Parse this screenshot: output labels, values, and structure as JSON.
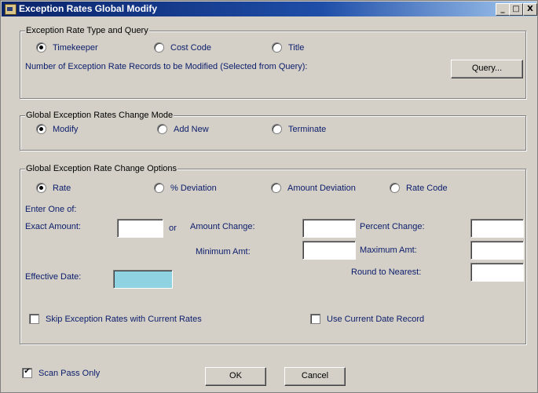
{
  "window": {
    "title": "Exception Rates Global Modify",
    "minimize": "_",
    "maximize": "□",
    "close": "X"
  },
  "type_query": {
    "legend": "Exception Rate Type and Query",
    "options": [
      {
        "label": "Timekeeper",
        "selected": true
      },
      {
        "label": "Cost Code",
        "selected": false
      },
      {
        "label": "Title",
        "selected": false
      }
    ],
    "records_label": "Number of Exception Rate Records to be Modified (Selected from Query):",
    "query_button": "Query..."
  },
  "change_mode": {
    "legend": "Global Exception Rates Change Mode",
    "options": [
      {
        "label": "Modify",
        "selected": true
      },
      {
        "label": "Add New",
        "selected": false
      },
      {
        "label": "Terminate",
        "selected": false
      }
    ]
  },
  "change_options": {
    "legend": "Global Exception Rate Change Options",
    "options": [
      {
        "label": "Rate",
        "selected": true
      },
      {
        "label": "% Deviation",
        "selected": false
      },
      {
        "label": "Amount Deviation",
        "selected": false
      },
      {
        "label": "Rate Code",
        "selected": false
      }
    ],
    "enter_one_of": "Enter One of:",
    "exact_amount_label": "Exact Amount:",
    "or_label": "or",
    "amount_change_label": "Amount Change:",
    "percent_change_label": "Percent Change:",
    "minimum_amt_label": "Minimum Amt:",
    "maximum_amt_label": "Maximum Amt:",
    "effective_date_label": "Effective Date:",
    "round_to_nearest_label": "Round to Nearest:",
    "exact_amount_value": "",
    "amount_change_value": "",
    "percent_change_value": "",
    "minimum_amt_value": "",
    "maximum_amt_value": "",
    "effective_date_value": "",
    "round_to_nearest_value": "",
    "skip_current_label": "Skip Exception Rates with Current Rates",
    "skip_current_checked": false,
    "use_current_date_label": "Use Current Date Record",
    "use_current_date_checked": false
  },
  "footer": {
    "scan_pass_label": "Scan Pass Only",
    "scan_pass_checked": true,
    "ok_button": "OK",
    "cancel_button": "Cancel"
  },
  "colors": {
    "title_bar_start": "#0a246a",
    "dialog_background": "#d4d0c8",
    "label_text": "#0a1c6b",
    "effective_date_field": "#8fd3e3"
  },
  "icons": {
    "app": "app-icon",
    "checkmark": "✔"
  }
}
